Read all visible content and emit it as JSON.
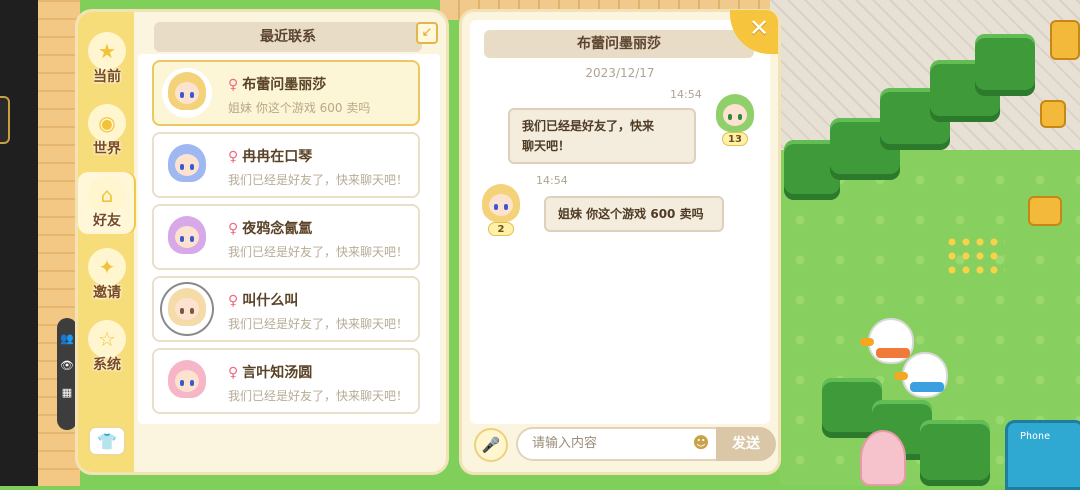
{
  "tabs": [
    {
      "label": "当前",
      "icon": "star-icon"
    },
    {
      "label": "世界",
      "icon": "planet-icon"
    },
    {
      "label": "好友",
      "icon": "house-icon"
    },
    {
      "label": "邀请",
      "icon": "invite-icon"
    },
    {
      "label": "系统",
      "icon": "system-icon"
    }
  ],
  "active_tab": "好友",
  "contacts_header": "最近联系",
  "contacts": [
    {
      "name": "布蕾问墨丽莎",
      "gender": "♀",
      "message": "姐妹 你这个游戏 600 卖吗",
      "hair": "#f4d27a"
    },
    {
      "name": "冉冉在口琴",
      "gender": "♀",
      "message": "我们已经是好友了，快来聊天吧！",
      "hair": "#9fb8f2"
    },
    {
      "name": "夜鸦念氤氲",
      "gender": "♀",
      "message": "我们已经是好友了，快来聊天吧！",
      "hair": "#d8a9e8"
    },
    {
      "name": "叫什么叫",
      "gender": "♀",
      "message": "我们已经是好友了，快来聊天吧！",
      "hair": "#f5dba8"
    },
    {
      "name": "言叶知汤圆",
      "gender": "♀",
      "message": "我们已经是好友了，快来聊天吧！",
      "hair": "#f6b6c8"
    }
  ],
  "chat": {
    "title": "布蕾问墨丽莎",
    "date": "2023/12/17",
    "messages": [
      {
        "time": "14:54",
        "text_line1": "我们已经是好友了，快来",
        "text_line2": "聊天吧！",
        "sender_level": "13",
        "side": "right"
      },
      {
        "time": "14:54",
        "text_line1": "姐妹 你这个游戏 600 卖吗",
        "sender_level": "2",
        "side": "left"
      }
    ],
    "input_placeholder": "请输入内容",
    "send_label": "发送"
  },
  "phone_booth_label": "Phone",
  "colors": {
    "accent": "#f7c53d",
    "panel": "#fbf4de",
    "tab_bar": "#f6dd7a"
  }
}
